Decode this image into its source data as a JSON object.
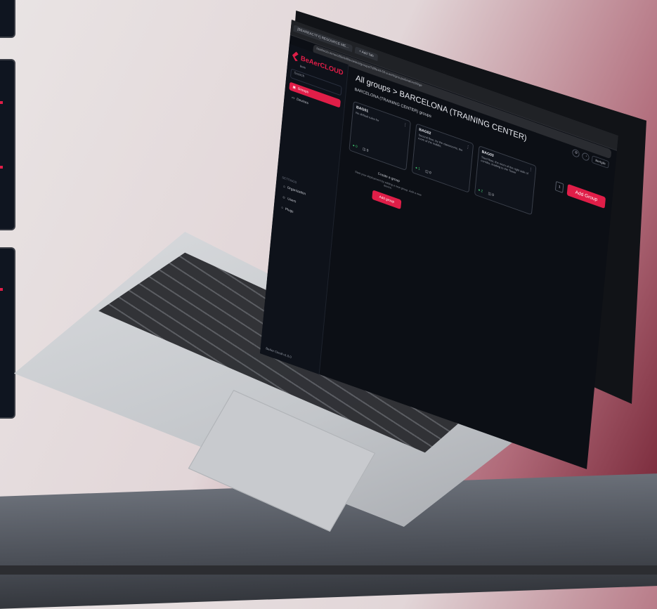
{
  "browser": {
    "tabs": [
      "[BEAREAC'ITY] RESOURCE ME...",
      "+ Add Tab"
    ],
    "url": "beaforclo.mme/c80efe/f8a-beie/a/groups/7d8fe4d-50-a-ae/ti/groups/beaforc00/ge"
  },
  "app": {
    "logo_text": "BeAerCLOUD",
    "logo_sub": "Beta",
    "search_placeholder": "Search",
    "nav": [
      {
        "label": "Groups",
        "icon": "groups-icon"
      },
      {
        "label": "Devices",
        "icon": "devices-icon"
      }
    ],
    "settings_label": "SETTINGS",
    "settings_nav": [
      {
        "label": "Organization",
        "icon": "organization-icon"
      },
      {
        "label": "Users",
        "icon": "users-icon"
      },
      {
        "label": "Plugs",
        "icon": "plug-icon"
      }
    ],
    "footer_text": "BeAer Cloud v1.0.0",
    "breadcrumb": "All groups > BARCELONA (TRAINING CENTER)",
    "subtitle": "BARCELONA (TRAINING CENTER) groups",
    "user_button": "BeAgile",
    "groups": [
      {
        "title": "BAG01",
        "desc": "No default rules for",
        "online": "0",
        "devices": "0"
      },
      {
        "title": "BAG02",
        "desc": "Second floor, by the classrooms, the room of the middle.",
        "online": "1",
        "devices": "0"
      },
      {
        "title": "BAG03",
        "desc": "Third floor, the room of the right side of corridor, leading to the Tower",
        "online": "2",
        "devices": "0"
      }
    ],
    "empty_group": {
      "title": "Create a group",
      "desc": "Start your deployment by adding a new group. Add a new device.",
      "button": "Add group"
    },
    "pager_label": "1",
    "add_group_button": "Add Group"
  },
  "colors": {
    "accent": "#e01e48",
    "bg": "#0c0f15",
    "success": "#3ec46d"
  }
}
